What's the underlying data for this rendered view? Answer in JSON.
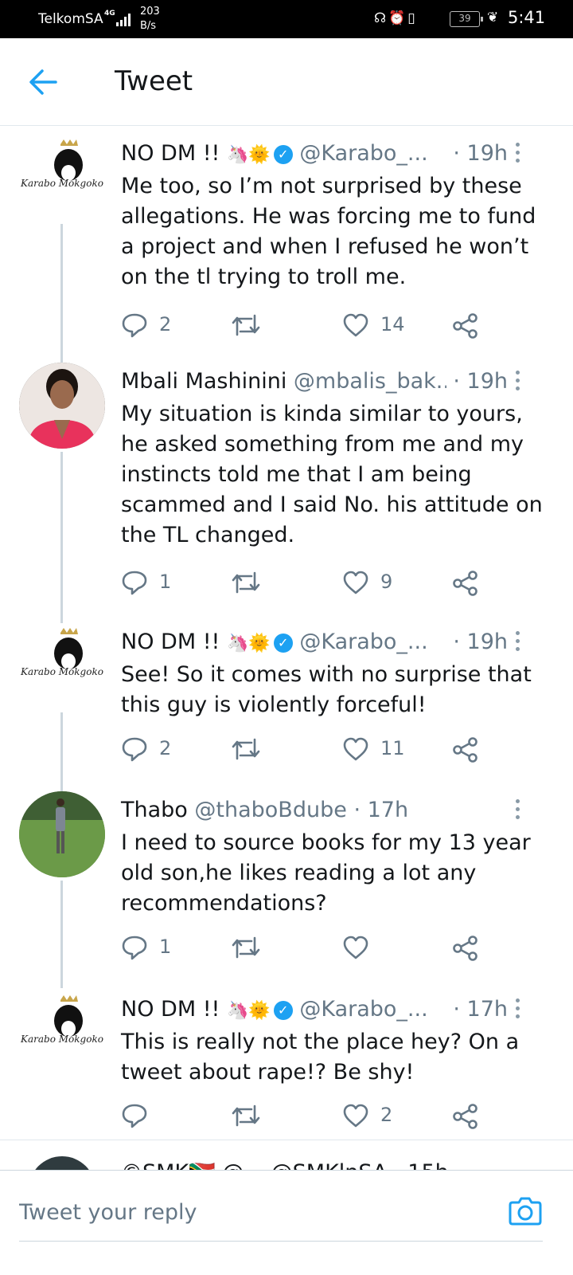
{
  "status_bar": {
    "carrier": "TelkomSA",
    "network": "4G",
    "speed_value": "203",
    "speed_unit": "B/s",
    "battery": "39",
    "time": "5:41"
  },
  "header": {
    "title": "Tweet",
    "back_icon": "arrow-left-icon"
  },
  "colors": {
    "accent": "#1da1f2",
    "text": "#14171a",
    "secondary": "#657786",
    "thread_line": "#ccd6dd"
  },
  "tweets": [
    {
      "name": "NO DM !!",
      "emojis": "🦄🌞",
      "verified": true,
      "handle": "@Karabo_...",
      "time": "· 19h",
      "avatar_label": "Karabo Mokgoko",
      "text": "Me too, so I’m not surprised by these allegations. He was forcing me to fund a project and when I refused he won’t on the tl trying to troll me.",
      "replies": "2",
      "retweets": "",
      "likes": "14"
    },
    {
      "name": "Mbali Mashinini",
      "emojis": "",
      "verified": false,
      "handle": "@mbalis_bak...",
      "time": "· 19h",
      "text": "My situation is kinda similar to yours, he asked something from me and my instincts told me that I am being scammed and I said No. his attitude on the TL changed.",
      "replies": "1",
      "retweets": "",
      "likes": "9"
    },
    {
      "name": "NO DM !!",
      "emojis": "🦄🌞",
      "verified": true,
      "handle": "@Karabo_...",
      "time": "· 19h",
      "avatar_label": "Karabo Mokgoko",
      "text": "See! So it comes with no surprise that this guy is violently forceful!",
      "replies": "2",
      "retweets": "",
      "likes": "11"
    },
    {
      "name": "Thabo",
      "emojis": "",
      "verified": false,
      "handle": "@thaboBdube",
      "time": "· 17h",
      "text": "I need to source books for my 13 year old son,he likes reading a lot any recommendations?",
      "replies": "1",
      "retweets": "",
      "likes": ""
    },
    {
      "name": "NO DM !!",
      "emojis": "🦄🌞",
      "verified": true,
      "handle": "@Karabo_...",
      "time": "· 17h",
      "avatar_label": "Karabo Mokgoko",
      "text": "This is really not the place hey? On a tweet about rape!? Be shy!",
      "replies": "",
      "retweets": "",
      "likes": "2"
    }
  ],
  "partial_tweet": {
    "text": "©SMK🇿🇦 @...  @SMKlnSA · 15h"
  },
  "reply": {
    "placeholder": "Tweet your reply",
    "camera_icon": "camera-icon"
  }
}
